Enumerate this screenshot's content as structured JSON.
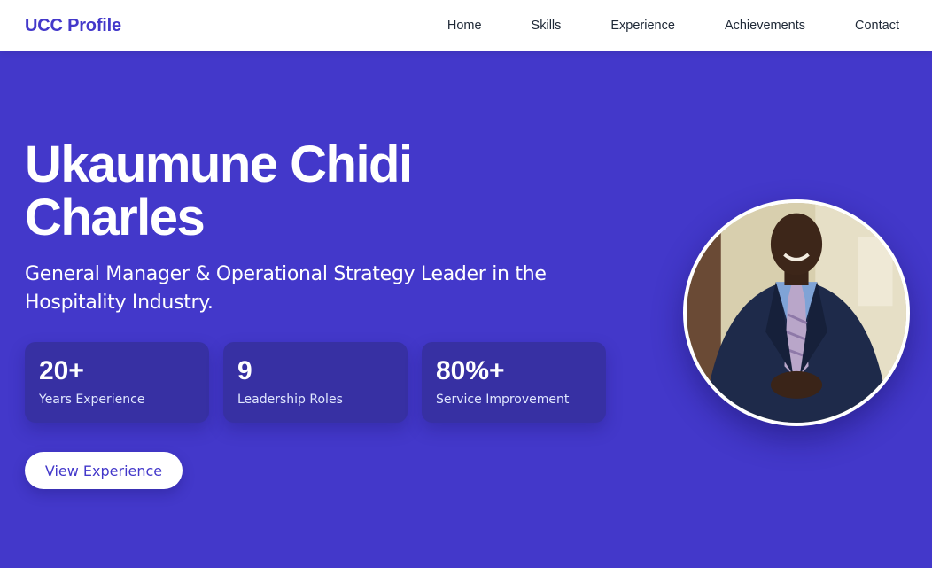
{
  "nav": {
    "brand": "UCC Profile",
    "links": [
      "Home",
      "Skills",
      "Experience",
      "Achievements",
      "Contact"
    ]
  },
  "hero": {
    "name": "Ukaumune Chidi Charles",
    "tagline": "General Manager & Operational Strategy Leader in the Hospitality Industry.",
    "stats": [
      {
        "value": "20+",
        "label": "Years Experience"
      },
      {
        "value": "9",
        "label": "Leadership Roles"
      },
      {
        "value": "80%+",
        "label": "Service Improvement"
      }
    ],
    "cta_label": "View Experience"
  },
  "colors": {
    "accent": "#4338ca",
    "card": "#3730a3",
    "nav_bg": "#ffffff",
    "text_light": "#ffffff"
  }
}
